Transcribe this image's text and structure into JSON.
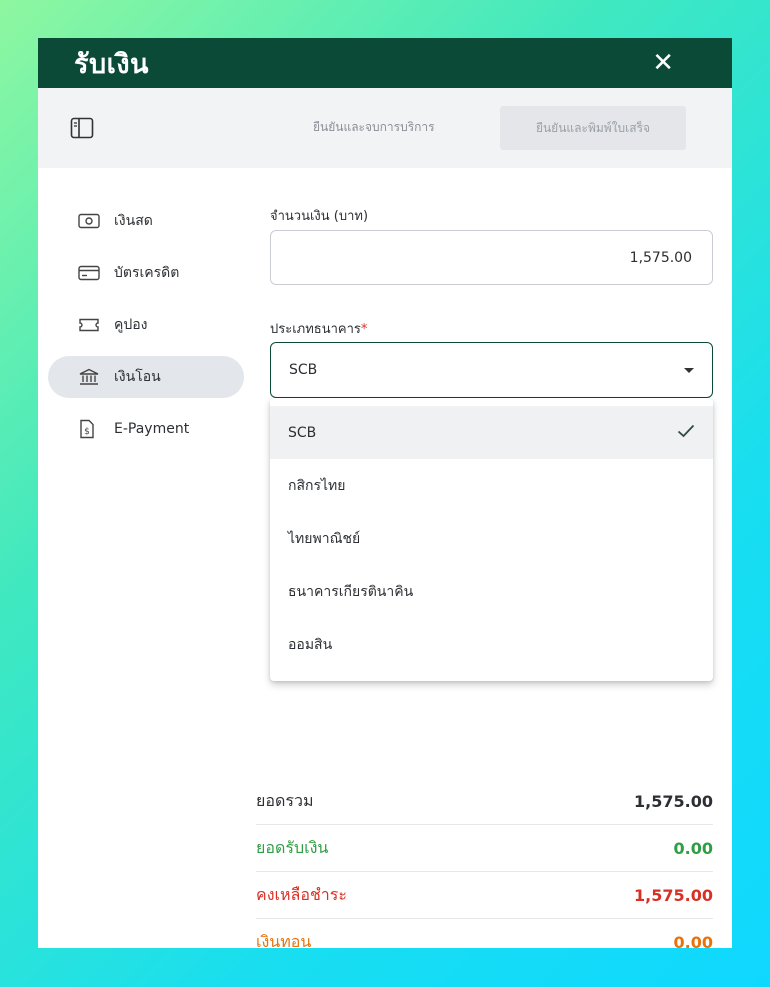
{
  "header": {
    "title": "รับเงิน",
    "close_label": "✕"
  },
  "toolbar": {
    "confirm_finish_label": "ยืนยันและจบการบริการ",
    "confirm_print_label": "ยืนยันและพิมพ์ใบเสร็จ"
  },
  "sidebar": {
    "items": [
      {
        "label": "เงินสด",
        "icon": "cash-icon"
      },
      {
        "label": "บัตรเครดิต",
        "icon": "credit-card-icon"
      },
      {
        "label": "คูปอง",
        "icon": "coupon-icon"
      },
      {
        "label": "เงินโอน",
        "icon": "bank-icon",
        "active": true
      },
      {
        "label": "E-Payment",
        "icon": "e-payment-icon"
      }
    ]
  },
  "form": {
    "amount_label": "จำนวนเงิน (บาท)",
    "amount_value": "1,575.00",
    "bank_label": "ประเภทธนาคาร",
    "bank_required": "*",
    "bank_selected": "SCB",
    "bank_options": [
      "SCB",
      "กสิกรไทย",
      "ไทยพาณิชย์",
      "ธนาคารเกียรตินาคิน",
      "ออมสิน"
    ]
  },
  "summary": {
    "rows": [
      {
        "label": "ยอดรวม",
        "value": "1,575.00",
        "color": "#2c2f33"
      },
      {
        "label": "ยอดรับเงิน",
        "value": "0.00",
        "color": "#2e9e44"
      },
      {
        "label": "คงเหลือชำระ",
        "value": "1,575.00",
        "color": "#d93025"
      },
      {
        "label": "เงินทอน",
        "value": "0.00",
        "color": "#e8730c"
      }
    ]
  },
  "colors": {
    "brand": "#0b4a36",
    "active_bg": "#e3e7ec"
  }
}
